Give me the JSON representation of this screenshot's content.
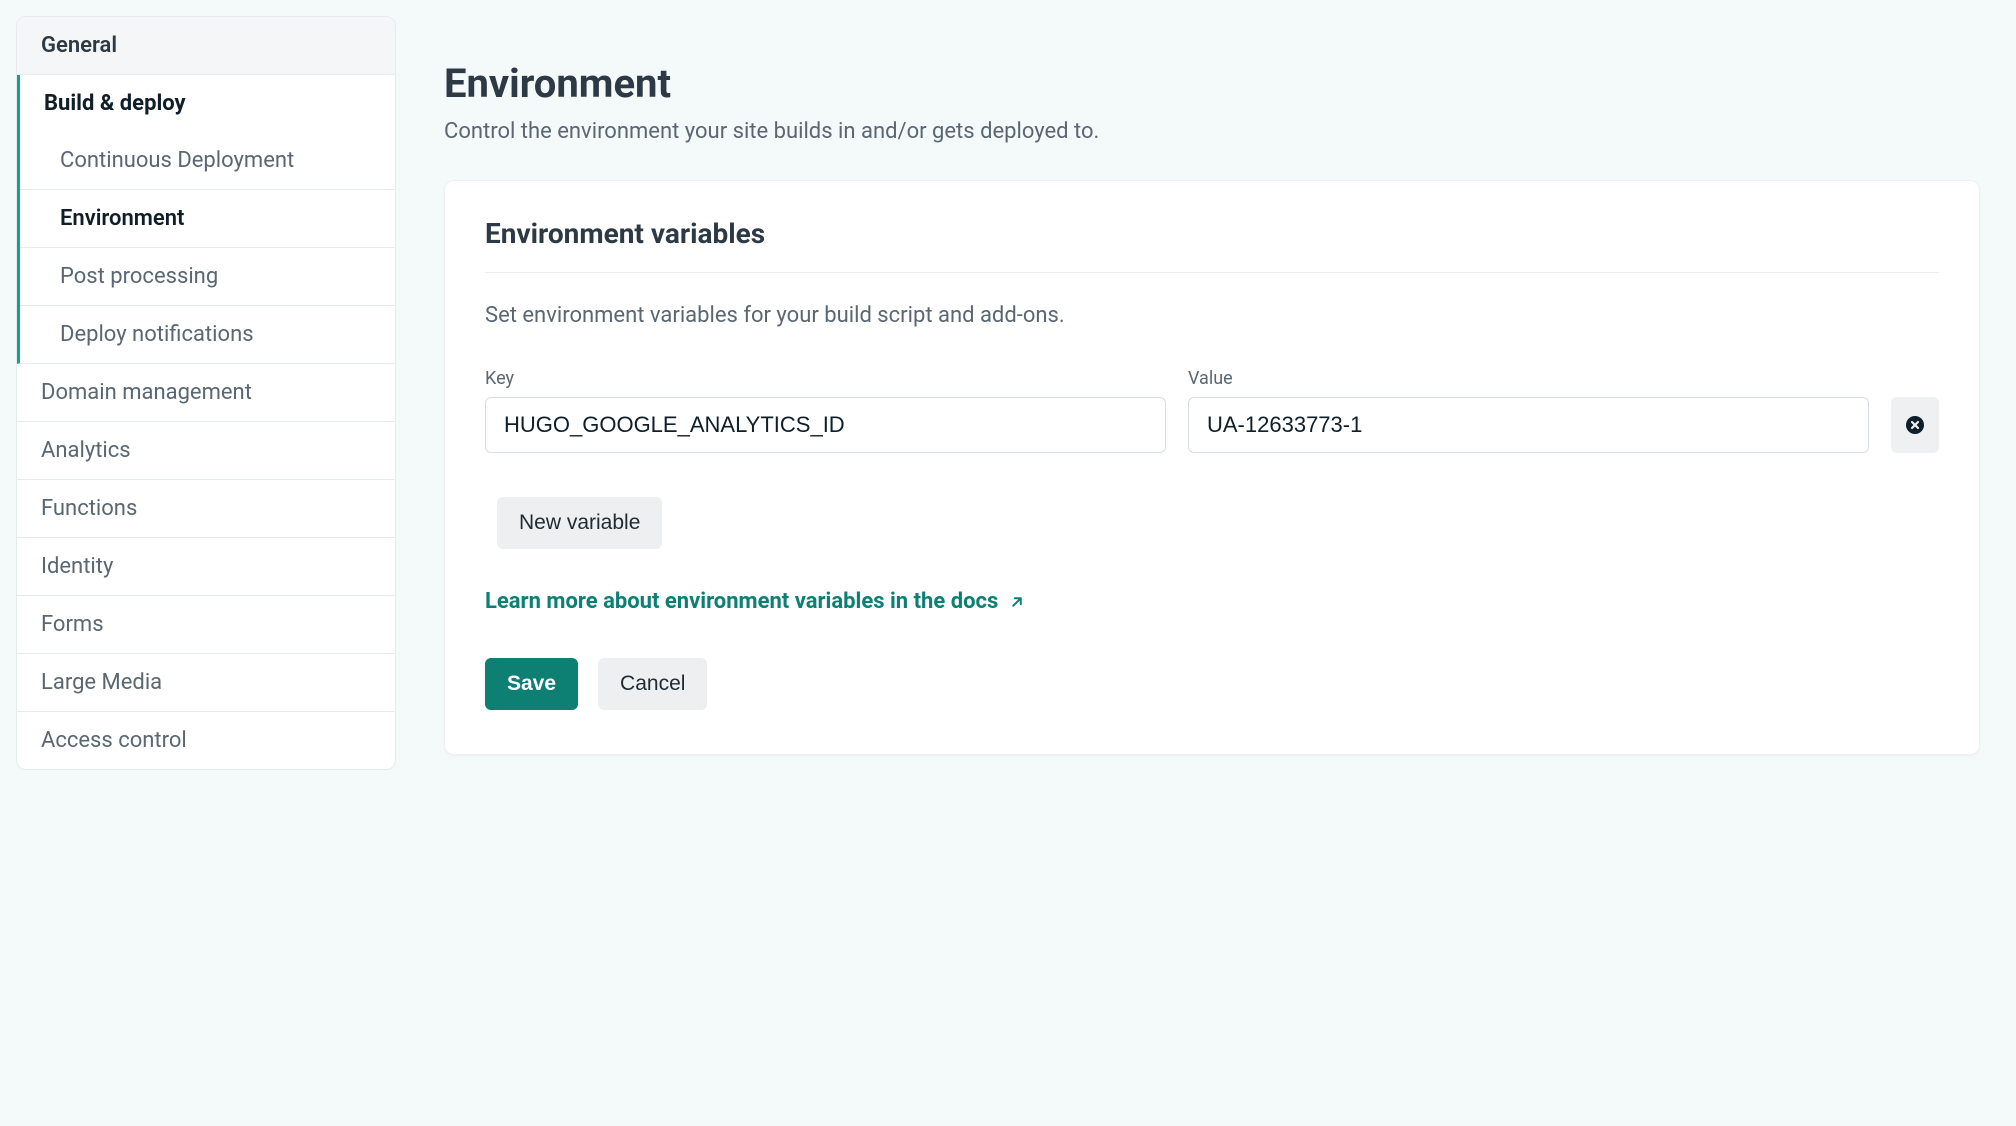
{
  "sidebar": {
    "items": [
      {
        "label": "General"
      },
      {
        "label": "Build & deploy",
        "sub": [
          {
            "label": "Continuous Deployment"
          },
          {
            "label": "Environment"
          },
          {
            "label": "Post processing"
          },
          {
            "label": "Deploy notifications"
          }
        ]
      },
      {
        "label": "Domain management"
      },
      {
        "label": "Analytics"
      },
      {
        "label": "Functions"
      },
      {
        "label": "Identity"
      },
      {
        "label": "Forms"
      },
      {
        "label": "Large Media"
      },
      {
        "label": "Access control"
      }
    ]
  },
  "page": {
    "title": "Environment",
    "subtitle": "Control the environment your site builds in and/or gets deployed to."
  },
  "card": {
    "title": "Environment variables",
    "description": "Set environment variables for your build script and add-ons.",
    "key_label": "Key",
    "value_label": "Value",
    "vars": [
      {
        "key": "HUGO_GOOGLE_ANALYTICS_ID",
        "value": "UA-12633773-1"
      }
    ],
    "new_variable_label": "New variable",
    "learn_more_label": "Learn more about environment variables in the docs",
    "save_label": "Save",
    "cancel_label": "Cancel"
  }
}
